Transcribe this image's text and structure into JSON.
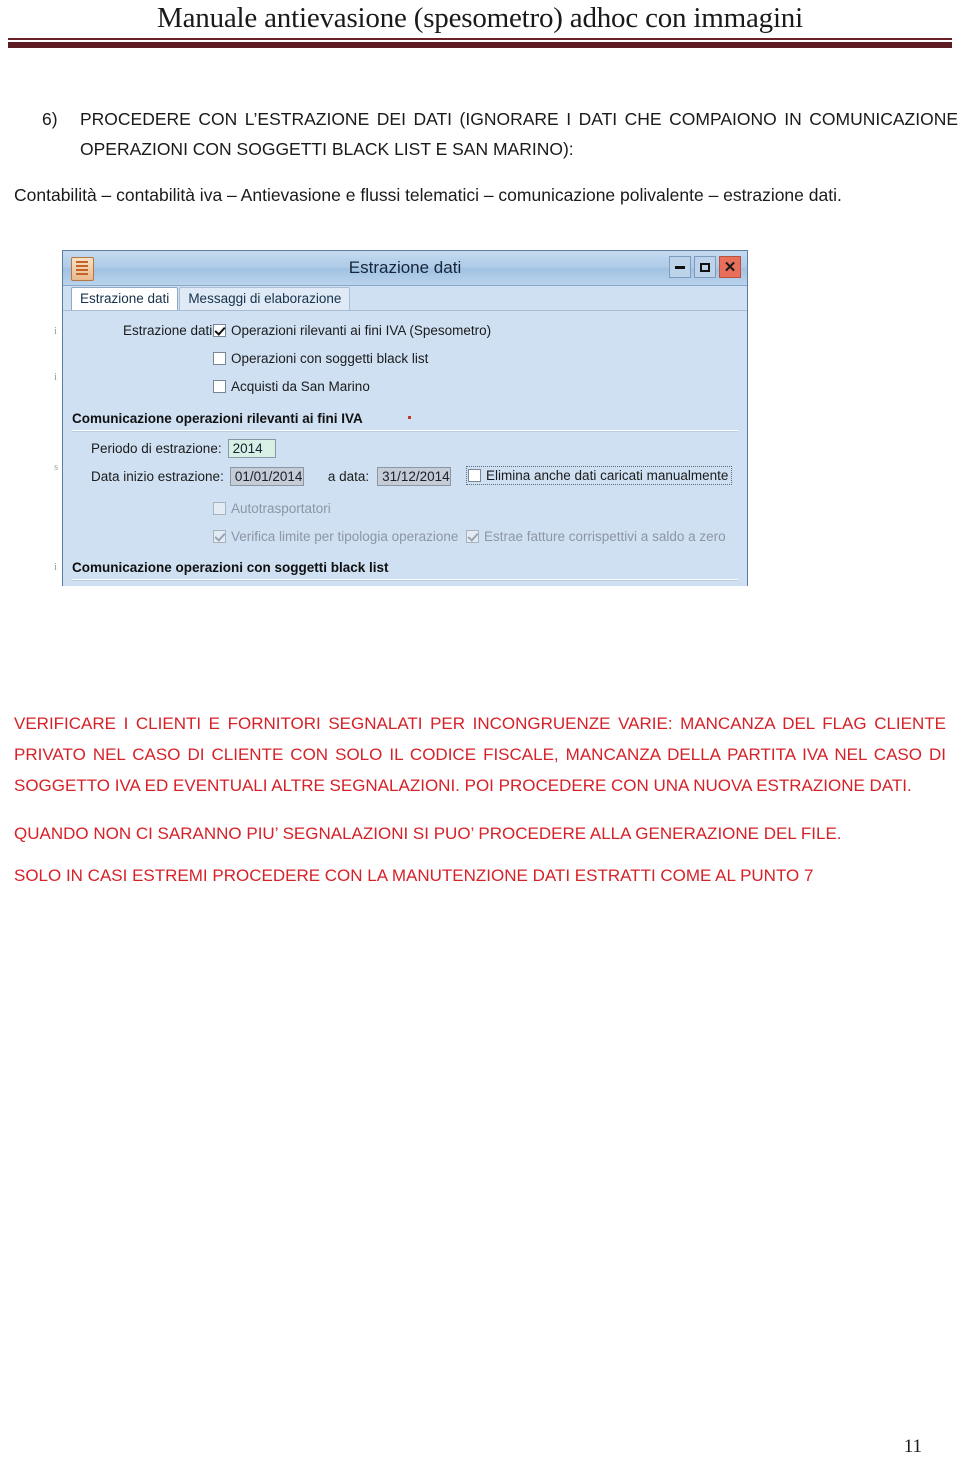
{
  "document": {
    "header_title": "Manuale antievasione (spesometro) adhoc con immagini",
    "page_number": "11"
  },
  "step": {
    "number": "6)",
    "text": "PROCEDERE CON L’ESTRAZIONE DEI DATI (IGNORARE I DATI CHE COMPAIONO IN COMUNICAZIONE OPERAZIONI CON SOGGETTI BLACK LIST E SAN MARINO):",
    "menu_path": "Contabilità – contabilità iva – Antievasione e flussi telematici – comunicazione polivalente – estrazione dati."
  },
  "screenshot": {
    "window": {
      "title": "Estrazione dati",
      "icon": "document-icon",
      "buttons": {
        "minimize": "minimize-icon",
        "maximize": "maximize-icon",
        "close": "✕"
      },
      "tabs": [
        {
          "label": "Estrazione dati",
          "active": true
        },
        {
          "label": "Messaggi di elaborazione",
          "active": false
        }
      ],
      "extraction": {
        "label": "Estrazione dati:",
        "options": [
          {
            "label": "Operazioni rilevanti ai fini IVA (Spesometro)",
            "checked": true,
            "enabled": true
          },
          {
            "label": "Operazioni con soggetti black list",
            "checked": false,
            "enabled": true
          },
          {
            "label": "Acquisti da San Marino",
            "checked": false,
            "enabled": true
          }
        ]
      },
      "section_iva": {
        "title": "Comunicazione operazioni rilevanti ai fini IVA",
        "period_label": "Periodo di estrazione:",
        "period_value": "2014",
        "date_from_label": "Data inizio estrazione:",
        "date_from_value": "01/01/2014",
        "date_to_label": "a data:",
        "date_to_value": "31/12/2014",
        "delete_manual_label": "Elimina anche dati caricati manualmente",
        "delete_manual_checked": false,
        "autotrasportatori_label": "Autotrasportatori",
        "autotrasportatori_checked": false,
        "verifica_limite_label": "Verifica limite per tipologia operazione",
        "verifica_limite_checked": true,
        "estrae_fatture_label": "Estrae fatture corrispettivi a saldo a zero",
        "estrae_fatture_checked": true
      },
      "section_blacklist": {
        "title": "Comunicazione operazioni con soggetti black list"
      }
    }
  },
  "notes": {
    "paragraph_1": "VERIFICARE I CLIENTI E FORNITORI SEGNALATI PER INCONGRUENZE VARIE: MANCANZA DEL FLAG CLIENTE PRIVATO NEL CASO DI CLIENTE CON SOLO IL CODICE FISCALE, MANCANZA DELLA PARTITA IVA NEL CASO DI SOGGETTO IVA ED EVENTUALI ALTRE SEGNALAZIONI. POI PROCEDERE CON UNA NUOVA ESTRAZIONE DATI.",
    "paragraph_2": "QUANDO NON CI SARANNO PIU’ SEGNALAZIONI SI PUO’ PROCEDERE ALLA GENERAZIONE DEL FILE.",
    "paragraph_3": "SOLO IN CASI ESTREMI PROCEDERE CON LA MANUTENZIONE DATI ESTRATTI COME AL PUNTO 7"
  },
  "colors": {
    "header_rule": "#5e1c22",
    "note_red": "#d62128",
    "window_bg": "#cfe0f2",
    "field_green": "#d6f0e6",
    "field_gray": "#c6ccd6",
    "close_button": "#e8705a"
  }
}
